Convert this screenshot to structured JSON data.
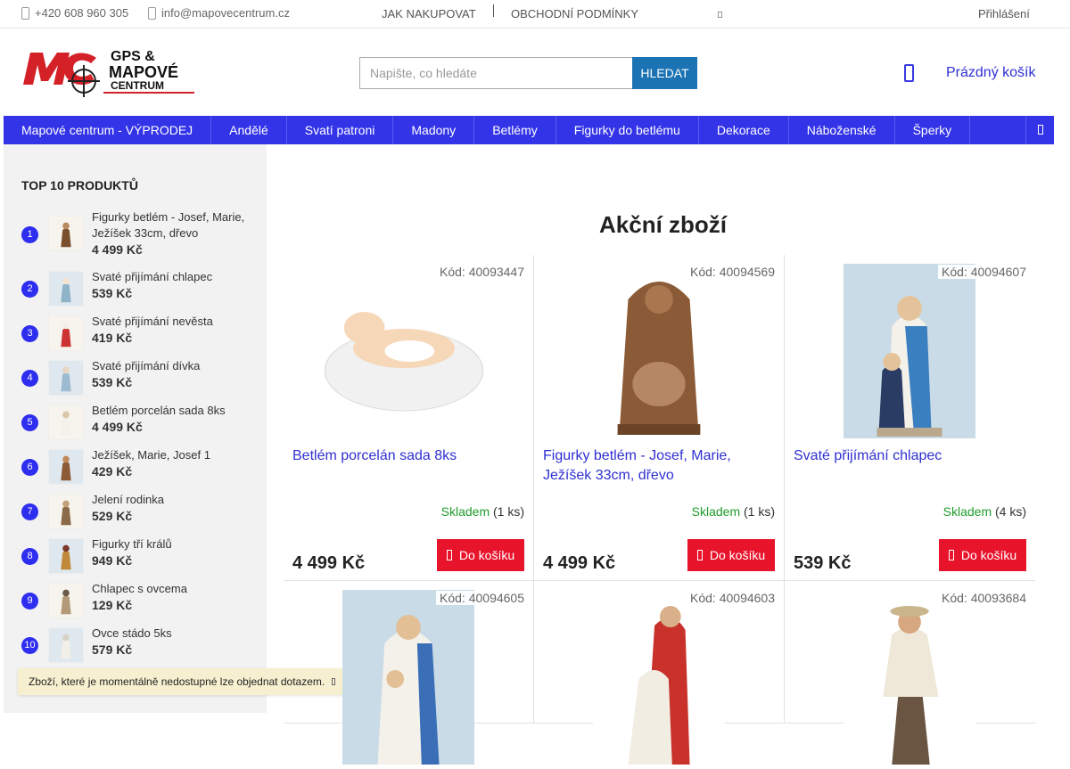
{
  "topbar": {
    "phone": "+420 608 960 305",
    "email": "info@mapovecentrum.cz",
    "link_how_to_buy": "JAK NAKUPOVAT",
    "link_terms": "OBCHODNÍ PODMÍNKY",
    "login": "Přihlášení"
  },
  "logo": {
    "mark": "MC",
    "line1": "GPS &",
    "line2": "MAPOVÉ",
    "line3": "CENTRUM",
    "brand_red": "#d42027"
  },
  "search": {
    "placeholder": "Napište, co hledáte",
    "button_label": "HLEDAT"
  },
  "cart": {
    "label": "Prázdný košík",
    "icon": "cart-icon"
  },
  "nav": {
    "items": [
      "Mapové centrum - VÝPRODEJ",
      "Andělé",
      "Svatí patroni",
      "Madony",
      "Betlémy",
      "Figurky do betlému",
      "Dekorace",
      "Náboženské",
      "Šperky"
    ],
    "color": "#3333e8"
  },
  "sidebar": {
    "heading": "TOP 10 PRODUKTŮ",
    "items": [
      {
        "rank": "1",
        "name": "Figurky betlém - Josef, Marie, Ježíšek 33cm, dřevo",
        "price": "4 499 Kč"
      },
      {
        "rank": "2",
        "name": "Svaté přijímání chlapec",
        "price": "539 Kč"
      },
      {
        "rank": "3",
        "name": "Svaté přijímání nevěsta",
        "price": "419 Kč"
      },
      {
        "rank": "4",
        "name": "Svaté přijímání dívka",
        "price": "539 Kč"
      },
      {
        "rank": "5",
        "name": "Betlém porcelán sada 8ks",
        "price": "4 499 Kč"
      },
      {
        "rank": "6",
        "name": "Ježíšek, Marie, Josef 1",
        "price": "429 Kč"
      },
      {
        "rank": "7",
        "name": "Jelení rodinka",
        "price": "529 Kč"
      },
      {
        "rank": "8",
        "name": "Figurky tří králů",
        "price": "949 Kč"
      },
      {
        "rank": "9",
        "name": "Chlapec s ovcema",
        "price": "129 Kč"
      },
      {
        "rank": "10",
        "name": "Ovce stádo 5ks",
        "price": "579 Kč"
      }
    ]
  },
  "notice": {
    "text": "Zboží, které je momentálně nedostupné lze objednat dotazem."
  },
  "main": {
    "title": "Akční zboží",
    "products": [
      {
        "code": "Kód: 40093447",
        "title": "Betlém porcelán sada 8ks",
        "stock_status": "Skladem",
        "stock_qty": "(1 ks)",
        "price": "4 499 Kč",
        "buy_label": "Do košíku"
      },
      {
        "code": "Kód: 40094569",
        "title": "Figurky betlém - Josef, Marie, Ježíšek 33cm, dřevo",
        "stock_status": "Skladem",
        "stock_qty": "(1 ks)",
        "price": "4 499 Kč",
        "buy_label": "Do košíku"
      },
      {
        "code": "Kód: 40094607",
        "title": "Svaté přijímání chlapec",
        "stock_status": "Skladem",
        "stock_qty": "(4 ks)",
        "price": "539 Kč",
        "buy_label": "Do košíku"
      },
      {
        "code": "Kód: 40094605"
      },
      {
        "code": "Kód: 40094603"
      },
      {
        "code": "Kód: 40093684"
      }
    ]
  },
  "colors": {
    "link_blue": "#2f2fd1",
    "stock_green": "#1f9d2a",
    "buy_red": "#e8142c",
    "search_blue": "#1b73b3"
  }
}
